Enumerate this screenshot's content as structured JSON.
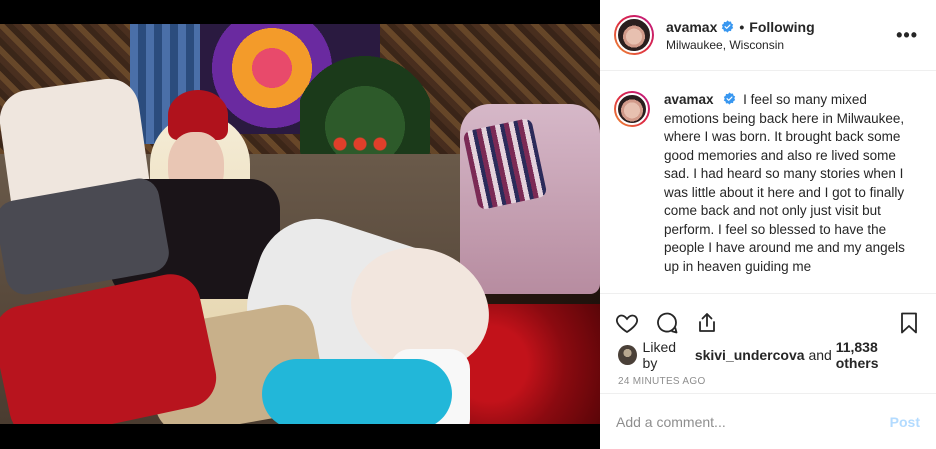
{
  "post": {
    "username": "avamax",
    "follow_status": "Following",
    "location": "Milwaukee, Wisconsin",
    "caption": "I feel so many mixed emotions being back here in Milwaukee, where I was born. It brought back some good memories and also re lived some sad. I had heard so many stories when I was little about it here and I got to finally come back and not only just visit but perform. I feel so blessed to have the people I have around me and my angels up in heaven guiding me",
    "likes": {
      "prefix": "Liked by",
      "liker": "skivi_undercova",
      "joiner": "and",
      "others": "11,838 others"
    },
    "timestamp": "24 MINUTES AGO"
  },
  "comment": {
    "placeholder": "Add a comment...",
    "post_label": "Post"
  },
  "icons": {
    "more": "more-options-icon",
    "like": "heart-icon",
    "comment": "comment-bubble-icon",
    "share": "share-icon",
    "save": "bookmark-icon",
    "verified": "verified-badge-icon"
  },
  "colors": {
    "verified": "#3897f0",
    "post_button_disabled": "#b3dbff",
    "muted_text": "#8e8e8e"
  }
}
